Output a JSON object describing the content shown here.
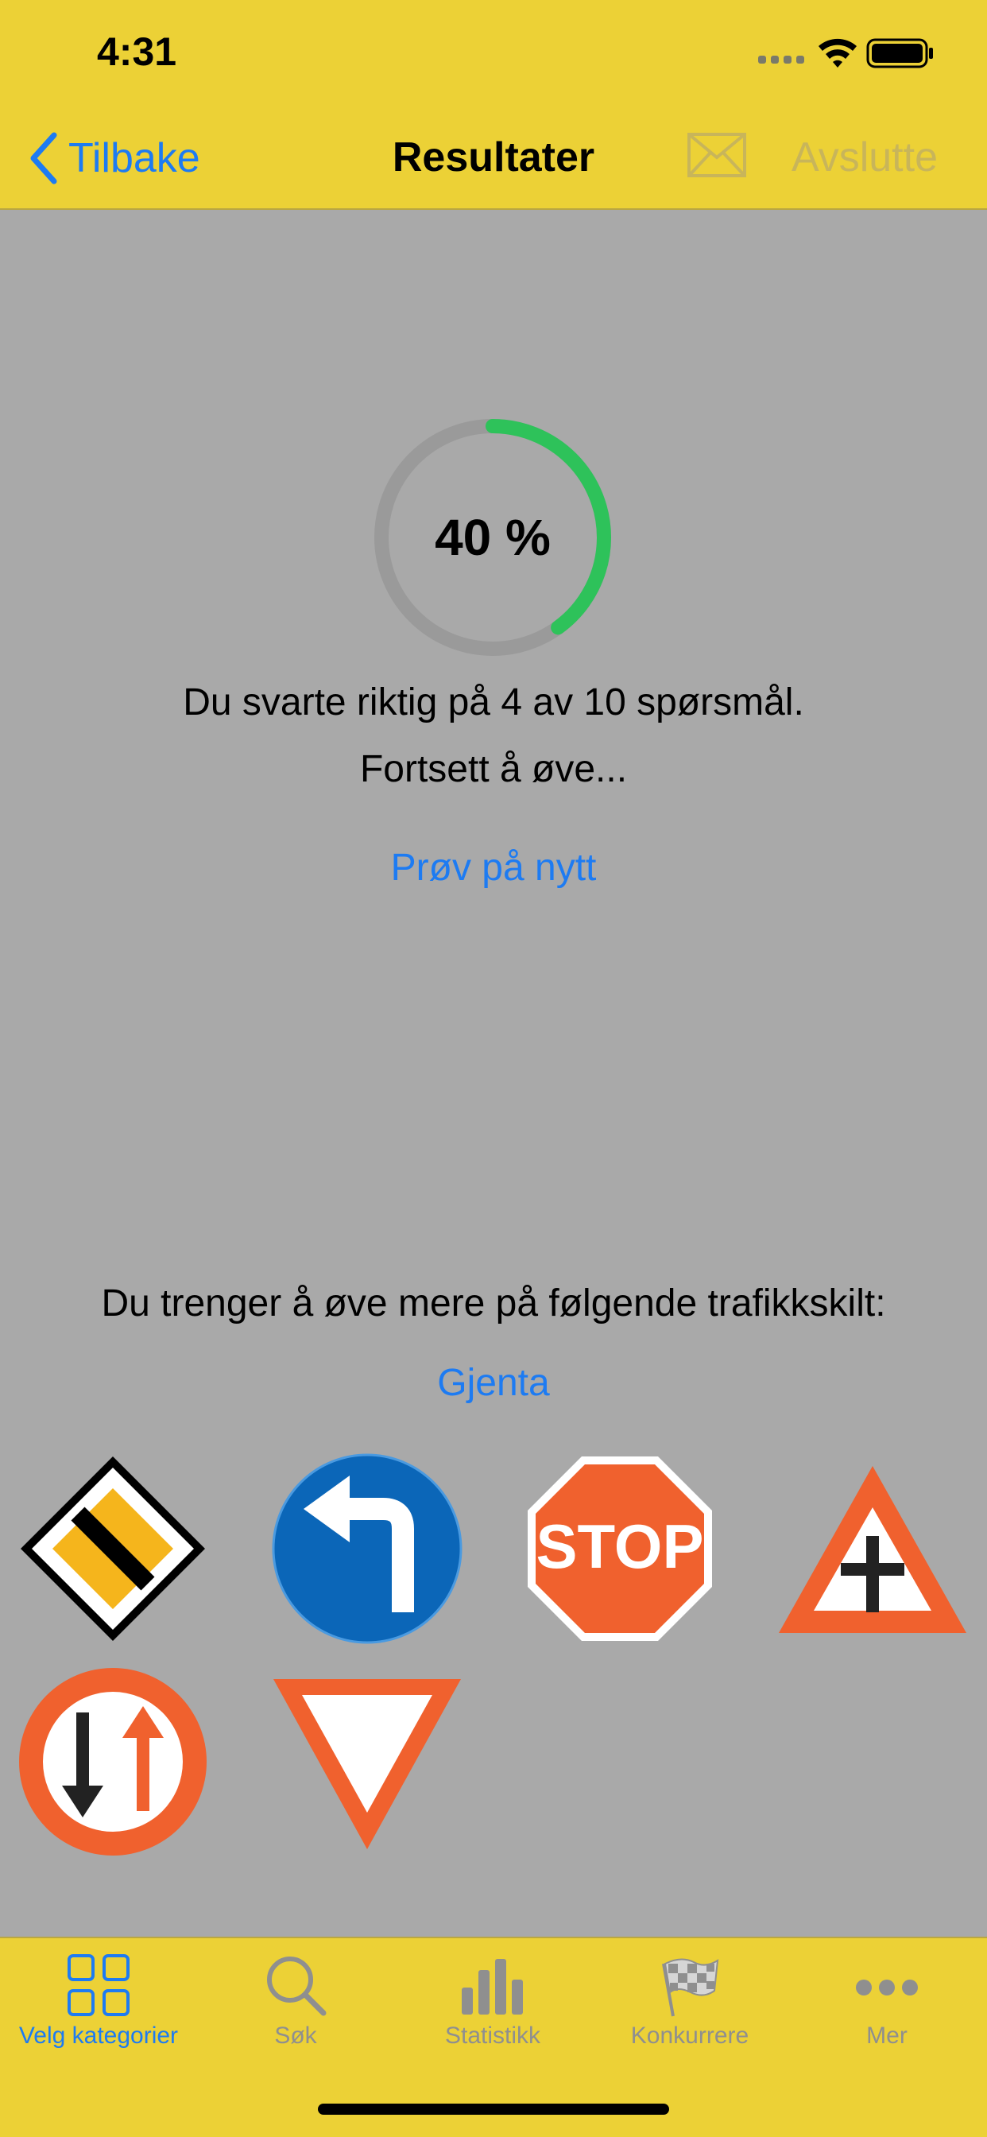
{
  "status": {
    "time": "4:31"
  },
  "nav": {
    "back_label": "Tilbake",
    "title": "Resultater",
    "exit_label": "Avslutte"
  },
  "result": {
    "percent_label": "40 %",
    "score_fraction": 0.4,
    "summary": "Du svarte riktig på 4 av 10 spørsmål.",
    "encouragement": "Fortsett å øve...",
    "retry_label": "Prøv på nytt"
  },
  "practice": {
    "heading": "Du trenger å øve mere på følgende trafikkskilt:",
    "repeat_label": "Gjenta"
  },
  "signs": [
    "priority-road-sign-icon",
    "turn-left-sign-icon",
    "stop-sign-icon",
    "crossroad-sign-icon",
    "oncoming-priority-sign-icon",
    "yield-sign-icon"
  ],
  "stop_text": "STOP",
  "tabs": [
    {
      "label": "Velg kategorier",
      "icon": "grid-icon",
      "active": true
    },
    {
      "label": "Søk",
      "icon": "search-icon",
      "active": false
    },
    {
      "label": "Statistikk",
      "icon": "bar-chart-icon",
      "active": false
    },
    {
      "label": "Konkurrere",
      "icon": "checkered-flag-icon",
      "active": false
    },
    {
      "label": "Mer",
      "icon": "more-icon",
      "active": false
    }
  ],
  "colors": {
    "bar": "#ecd136",
    "background": "#a9a9a9",
    "accent": "#1d7bf2",
    "progress": "#2ec25a",
    "track": "#9a9a9a",
    "sign_red": "#f0612e",
    "sign_blue": "#0b66b8"
  }
}
